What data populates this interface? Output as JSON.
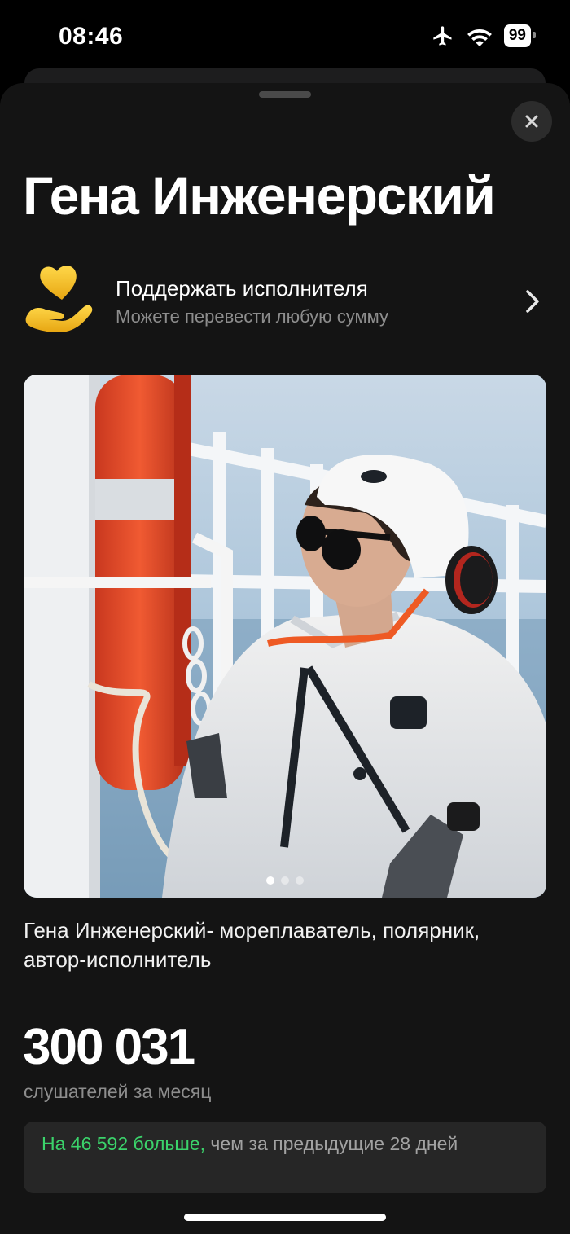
{
  "status_bar": {
    "time": "08:46",
    "battery": "99",
    "icons": [
      "airplane-icon",
      "wifi-icon",
      "battery-icon"
    ]
  },
  "artist": {
    "name": "Гена Инженерский"
  },
  "support": {
    "title": "Поддержать исполнителя",
    "subtitle": "Можете перевести любую сумму",
    "icon": "heart-hand-icon"
  },
  "gallery": {
    "image": "artist-photo",
    "page_count": 3,
    "active_page": 1
  },
  "bio": "Гена Инженерский- мореплаватель, полярник, автор-исполнитель",
  "stats": {
    "listeners": "300 031",
    "listeners_label": "слушателей за месяц",
    "delta_highlight": "На 46 592 больше,",
    "delta_rest": " чем за предыдущие 28 дней"
  },
  "colors": {
    "background": "#141414",
    "accent_green": "#3bd36b",
    "accent_gold": "#f7c51b"
  }
}
